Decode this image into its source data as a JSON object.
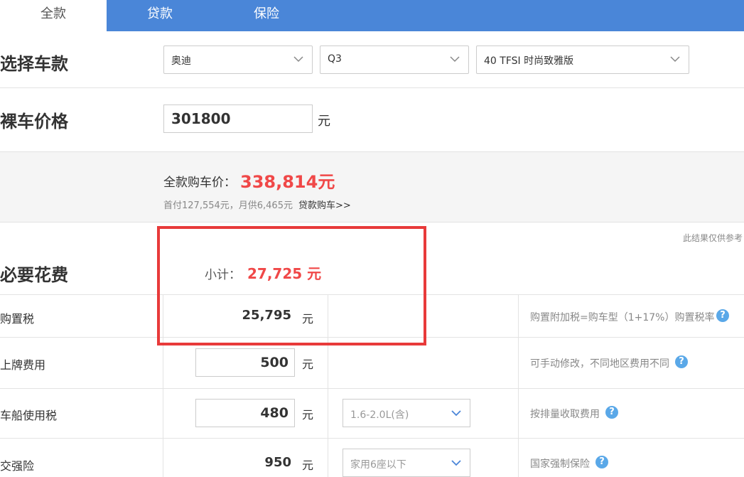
{
  "tabs": [
    {
      "label": "全款"
    },
    {
      "label": "贷款"
    },
    {
      "label": "保险"
    }
  ],
  "select_car": {
    "title": "选择车款",
    "brand": "奥迪",
    "model": "Q3",
    "trim": "40 TFSI 时尚致雅版"
  },
  "bare_price": {
    "title": "裸车价格",
    "value": "301800",
    "unit": "元"
  },
  "summary": {
    "label": "全款购车价：",
    "value": "338,814元",
    "sub": "首付127,554元，月供6,465元",
    "link": "贷款购车>>"
  },
  "note": "此结果仅供参考",
  "required": {
    "title": "必要花费",
    "subtotal_label": "小计：",
    "subtotal_value": "27,725 元"
  },
  "rows": [
    {
      "label": "购置税",
      "value": "25,795",
      "unit": "元",
      "hint": "购置附加税=购车型（1+17%）购置税率"
    },
    {
      "label": "上牌费用",
      "value": "500",
      "unit": "元",
      "hint": "可手动修改，不同地区费用不同"
    },
    {
      "label": "车船使用税",
      "value": "480",
      "unit": "元",
      "option": "1.6-2.0L(含)",
      "hint": "按排量收取费用"
    },
    {
      "label": "交强险",
      "value": "950",
      "unit": "元",
      "option": "家用6座以下",
      "hint": "国家强制保险"
    }
  ],
  "help_icon": "?",
  "colors": {
    "tab_bar": "#4a86d8",
    "price_red": "#f04848",
    "highlight_box": "#e83a3a",
    "help_icon": "#5aa8e8"
  }
}
